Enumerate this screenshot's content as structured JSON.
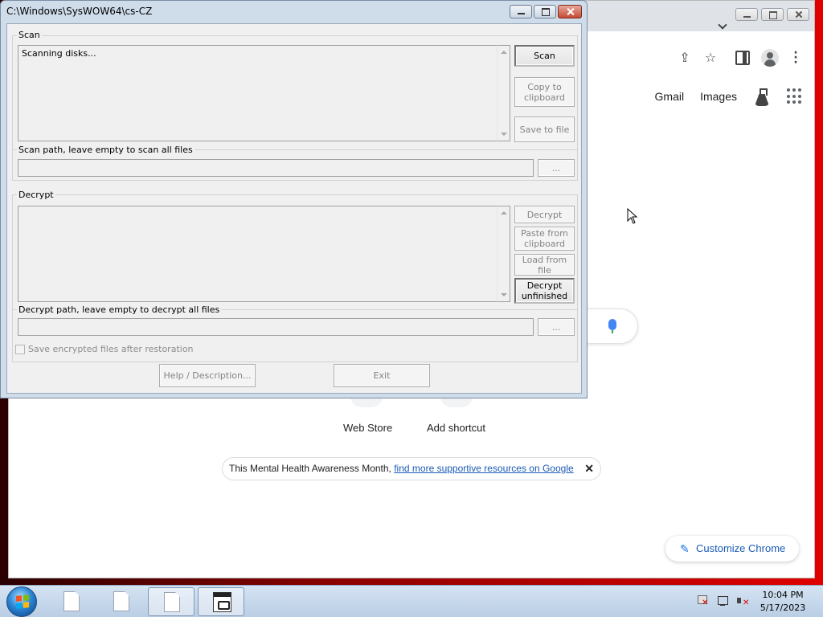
{
  "chrome": {
    "links": {
      "gmail": "Gmail",
      "images": "Images"
    },
    "shortcuts": {
      "web_store": "Web Store",
      "add_shortcut": "Add shortcut"
    },
    "notice": {
      "text": "This Mental Health Awareness Month, ",
      "link": "find more supportive resources on Google",
      "close": "✕"
    },
    "customize_label": "Customize Chrome",
    "icons": [
      "share-icon",
      "star-icon",
      "side-panel-icon",
      "profile-icon",
      "menu-icon",
      "labs-icon",
      "apps-icon",
      "mic-icon",
      "pencil-icon"
    ]
  },
  "dialog": {
    "title": "C:\\Windows\\SysWOW64\\cs-CZ",
    "scan": {
      "group_label": "Scan",
      "output_text": "Scanning disks...",
      "scan_button": "Scan",
      "copy_button": "Copy to clipboard",
      "save_button": "Save to file",
      "path_label": "Scan path, leave empty to scan all files",
      "browse_button": "..."
    },
    "decrypt": {
      "group_label": "Decrypt",
      "output_text": "",
      "decrypt_button": "Decrypt",
      "paste_button": "Paste from clipboard",
      "load_button": "Load from file",
      "unfinished_button": "Decrypt unfinished",
      "path_label": "Decrypt path, leave empty to decrypt all files",
      "browse_button": "...",
      "checkbox_label": "Save encrypted files after restoration"
    },
    "help_button": "Help / Description...",
    "exit_button": "Exit"
  },
  "taskbar": {
    "time": "10:04 PM",
    "date": "5/17/2023"
  },
  "colors": {
    "desktop": "#d00000",
    "chrome_link": "#1a5bb5",
    "dialog_frame": "#cfdcea",
    "taskbar": "#c8d8ea"
  }
}
